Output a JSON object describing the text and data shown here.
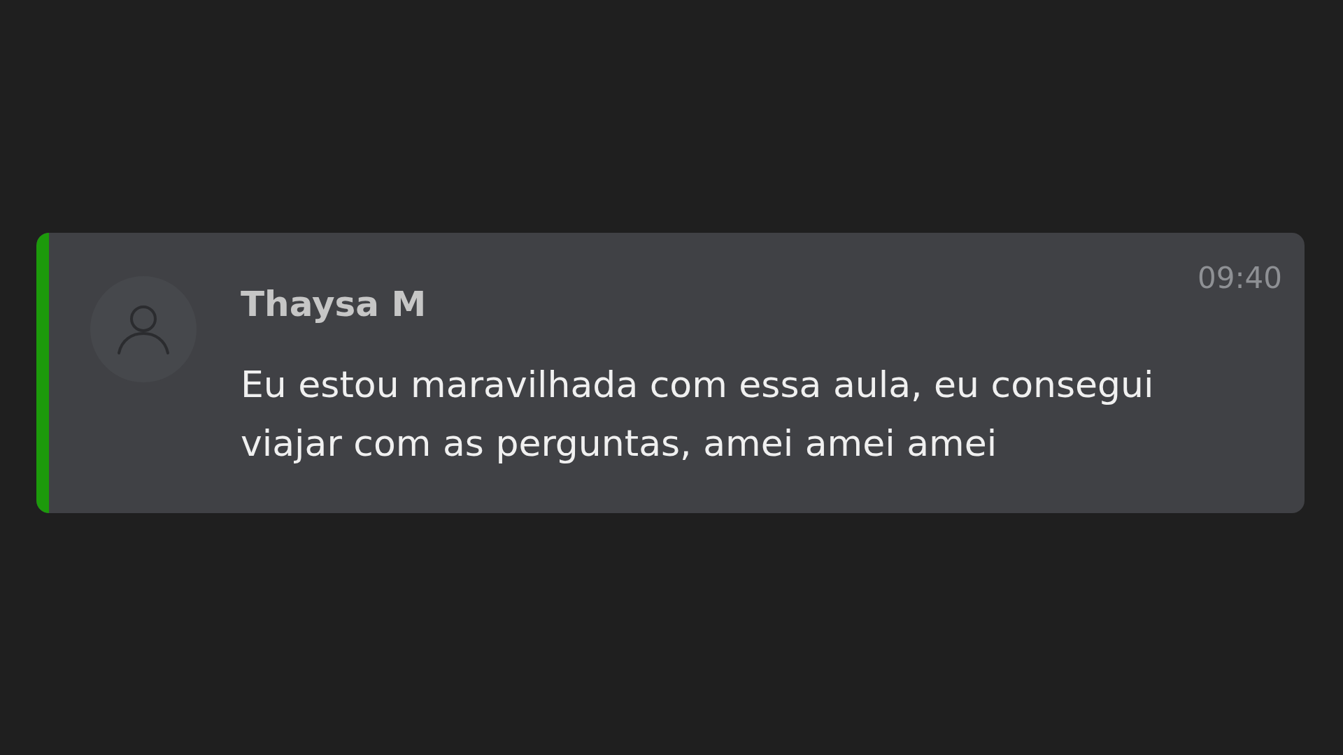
{
  "messages": [
    {
      "author": "Thaysa M",
      "time": "09:40",
      "text": "Eu estou maravilhada com essa aula, eu consegui viajar com as perguntas, amei amei amei",
      "color": "#1c9a0b"
    }
  ]
}
